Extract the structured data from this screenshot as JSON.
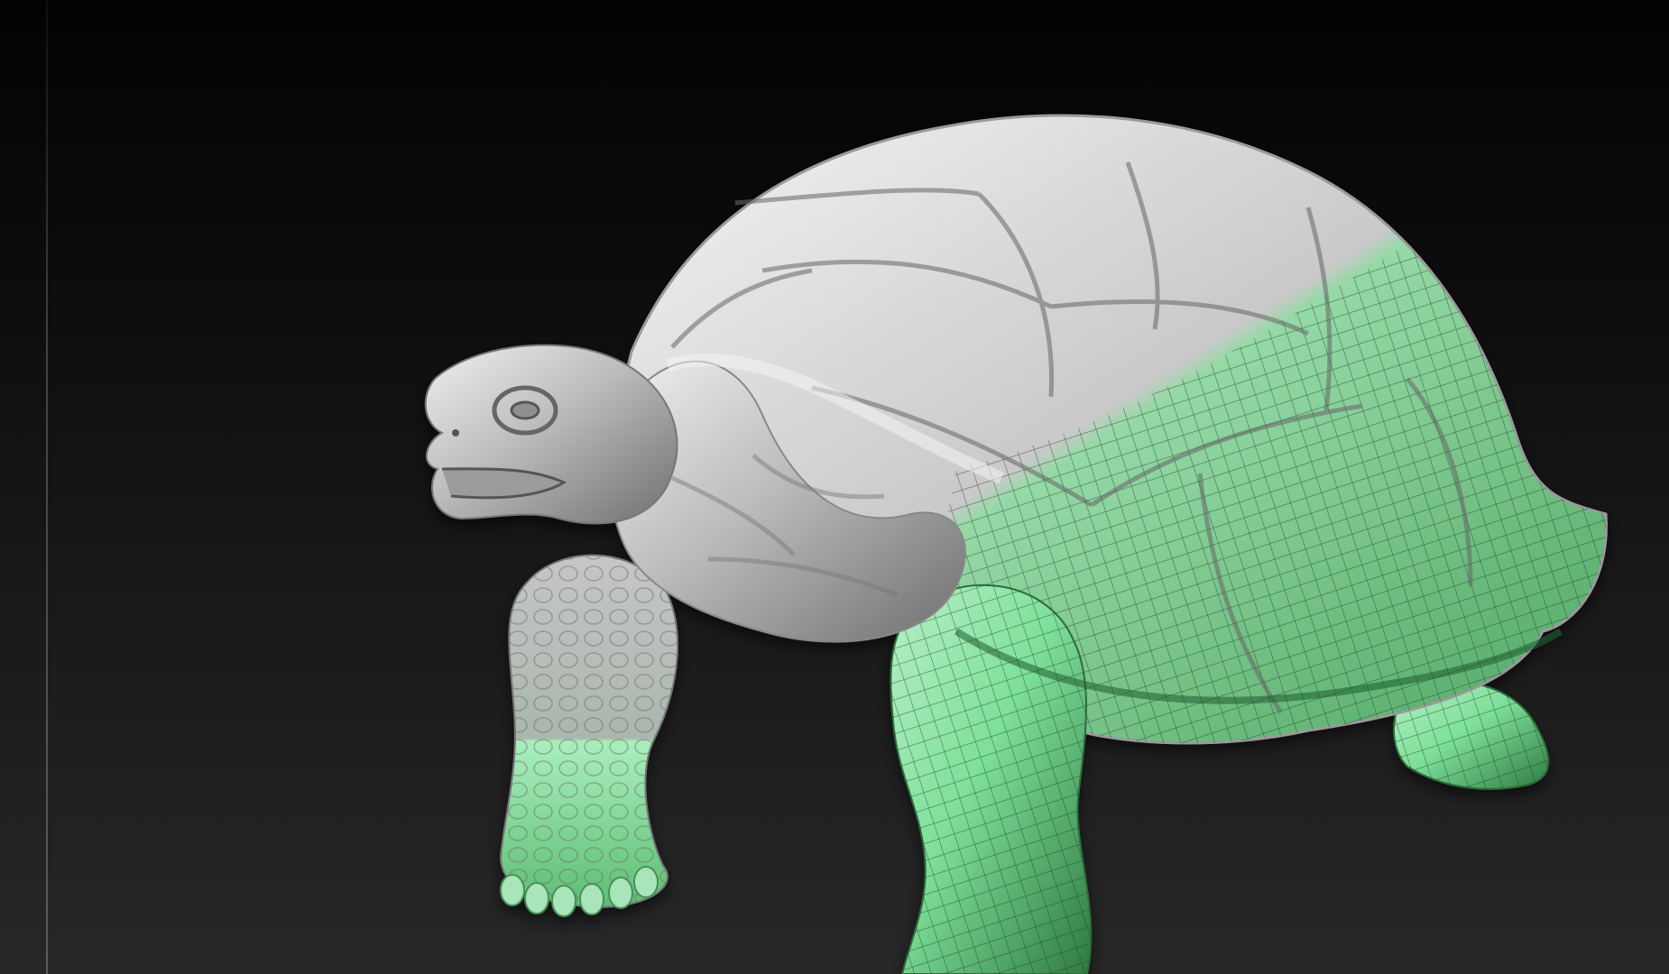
{
  "viewport": {
    "background_color": "#101010",
    "divider_color": "#5b5b5b",
    "model_name": "tortoise",
    "clay_color": "#bdbdbd",
    "mask_color": "#7ee09a",
    "wireframe_color": "#1b3d25"
  }
}
